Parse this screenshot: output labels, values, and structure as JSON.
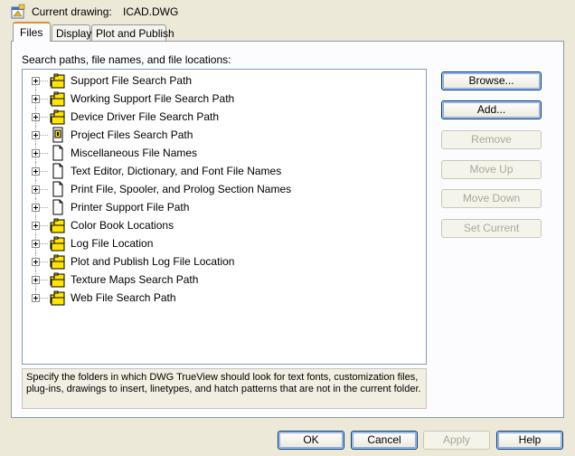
{
  "header": {
    "label": "Current drawing:",
    "value": "ICAD.DWG"
  },
  "tabs": [
    {
      "label": "Files",
      "active": true
    },
    {
      "label": "Display",
      "active": false
    },
    {
      "label": "Plot and Publish",
      "active": false
    }
  ],
  "tree": {
    "caption": "Search paths, file names, and file locations:",
    "items": [
      {
        "label": "Support File Search Path",
        "icon": "folders-icon"
      },
      {
        "label": "Working Support File Search Path",
        "icon": "folders-icon"
      },
      {
        "label": "Device Driver File Search Path",
        "icon": "folders-icon"
      },
      {
        "label": "Project Files Search Path",
        "icon": "project-file-icon"
      },
      {
        "label": "Miscellaneous File Names",
        "icon": "document-icon"
      },
      {
        "label": "Text Editor, Dictionary, and Font File Names",
        "icon": "document-icon"
      },
      {
        "label": "Print File, Spooler, and Prolog Section Names",
        "icon": "document-icon"
      },
      {
        "label": "Printer Support File Path",
        "icon": "document-icon"
      },
      {
        "label": "Color Book Locations",
        "icon": "folders-icon"
      },
      {
        "label": "Log File Location",
        "icon": "folders-icon"
      },
      {
        "label": "Plot and Publish Log File Location",
        "icon": "folders-icon"
      },
      {
        "label": "Texture Maps Search Path",
        "icon": "folders-icon"
      },
      {
        "label": "Web File Search Path",
        "icon": "folders-icon"
      }
    ]
  },
  "description": "Specify the folders in which DWG TrueView should look for text fonts, customization files, plug-ins, drawings to insert, linetypes, and hatch patterns that are not in the current folder.",
  "side_buttons": {
    "browse": "Browse...",
    "add": "Add...",
    "remove": "Remove",
    "move_up": "Move Up",
    "move_down": "Move Down",
    "set_current": "Set Current"
  },
  "footer_buttons": {
    "ok": "OK",
    "cancel": "Cancel",
    "apply": "Apply",
    "help": "Help"
  },
  "colors": {
    "folder_yellow": "#ffe500",
    "tab_accent": "#e68b2c",
    "button_border": "#003c74",
    "disabled_text": "#aca899"
  }
}
